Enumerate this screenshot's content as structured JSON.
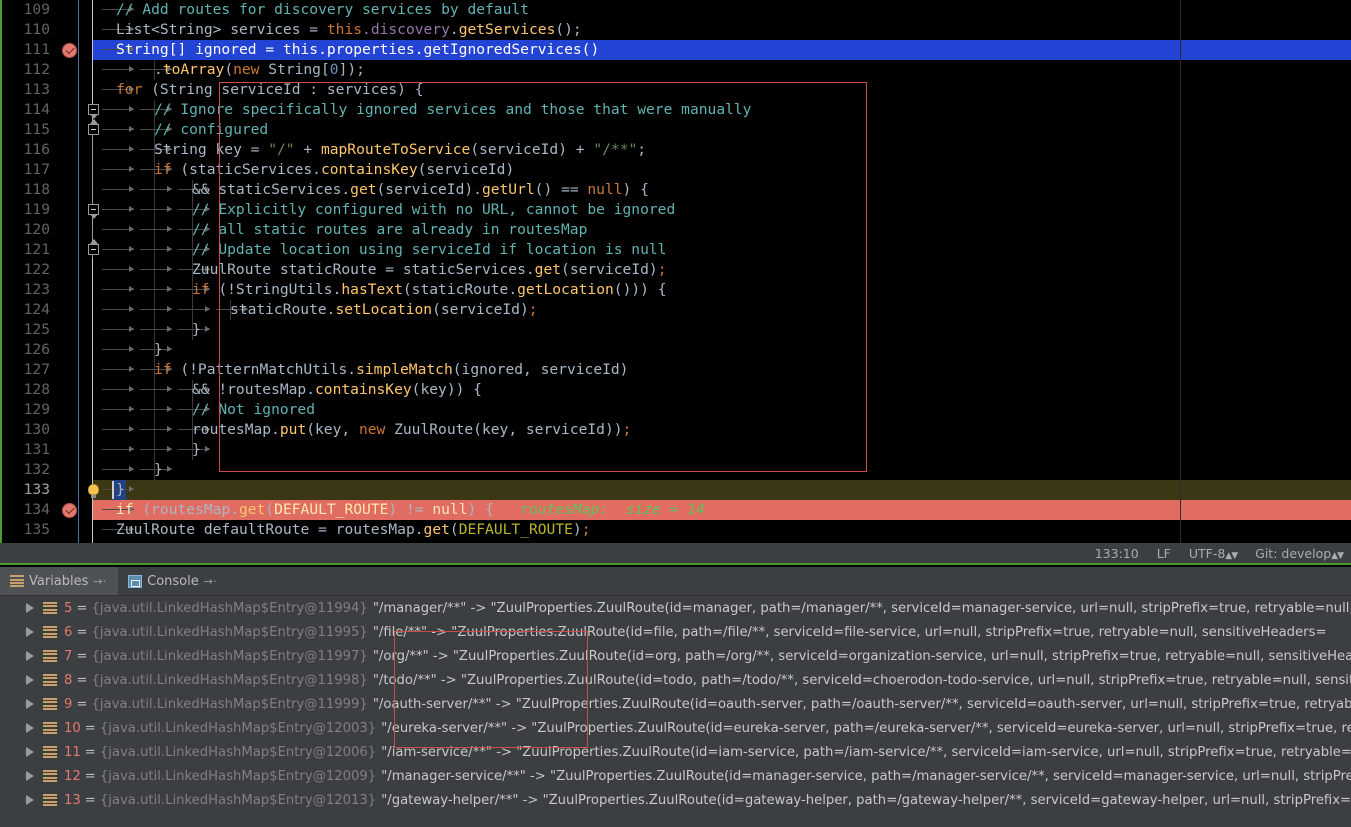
{
  "editor": {
    "first_line": 109,
    "lines": [
      {
        "n": 109,
        "state": "normal",
        "segs": [
          {
            "t": "// Add routes for discovery services by default",
            "c": "cmt2"
          }
        ],
        "indent": 114
      },
      {
        "n": 110,
        "state": "normal",
        "segs": [
          {
            "t": "List<String> services = ",
            "c": "pln"
          },
          {
            "t": "this",
            "c": "kw"
          },
          {
            "t": ".discovery",
            "c": "fld"
          },
          {
            "t": ".",
            "c": "pln"
          },
          {
            "t": "getServices",
            "c": "mth"
          },
          {
            "t": "();",
            "c": "pln"
          }
        ],
        "indent": 114
      },
      {
        "n": 111,
        "state": "exec",
        "segs": [
          {
            "t": "String[] ignored = this.properties.getIgnoredServices()",
            "c": "pln"
          }
        ],
        "indent": 114
      },
      {
        "n": 112,
        "state": "normal",
        "segs": [
          {
            "t": ".",
            "c": "pln"
          },
          {
            "t": "toArray",
            "c": "mth"
          },
          {
            "t": "(",
            "c": "pln"
          },
          {
            "t": "new",
            "c": "kw"
          },
          {
            "t": " String[",
            "c": "pln"
          },
          {
            "t": "0",
            "c": "num"
          },
          {
            "t": "]);",
            "c": "pln"
          }
        ],
        "indent": 152
      },
      {
        "n": 113,
        "state": "normal",
        "segs": [
          {
            "t": "for",
            "c": "kw"
          },
          {
            "t": " (String serviceId : services) {",
            "c": "pln"
          }
        ],
        "indent": 114
      },
      {
        "n": 114,
        "state": "normal",
        "segs": [
          {
            "t": "// Ignore specifically ignored services and those that were manually",
            "c": "cmt2"
          }
        ],
        "indent": 152
      },
      {
        "n": 115,
        "state": "normal",
        "segs": [
          {
            "t": "// configured",
            "c": "cmt2"
          }
        ],
        "indent": 152
      },
      {
        "n": 116,
        "state": "normal",
        "segs": [
          {
            "t": "String key = ",
            "c": "pln"
          },
          {
            "t": "\"/\"",
            "c": "str"
          },
          {
            "t": " + ",
            "c": "pln"
          },
          {
            "t": "mapRouteToService",
            "c": "mth"
          },
          {
            "t": "(serviceId) + ",
            "c": "pln"
          },
          {
            "t": "\"/**\"",
            "c": "str"
          },
          {
            "t": ";",
            "c": "pln"
          }
        ],
        "indent": 152
      },
      {
        "n": 117,
        "state": "normal",
        "segs": [
          {
            "t": "if",
            "c": "kw"
          },
          {
            "t": " (staticServices.",
            "c": "pln"
          },
          {
            "t": "containsKey",
            "c": "mth"
          },
          {
            "t": "(serviceId)",
            "c": "pln"
          }
        ],
        "indent": 152
      },
      {
        "n": 118,
        "state": "normal",
        "segs": [
          {
            "t": "&& staticServices.",
            "c": "pln"
          },
          {
            "t": "get",
            "c": "mth"
          },
          {
            "t": "(serviceId).",
            "c": "pln"
          },
          {
            "t": "getUrl",
            "c": "mth"
          },
          {
            "t": "() == ",
            "c": "pln"
          },
          {
            "t": "null",
            "c": "kw"
          },
          {
            "t": ") {",
            "c": "pln"
          }
        ],
        "indent": 190
      },
      {
        "n": 119,
        "state": "normal",
        "segs": [
          {
            "t": "// Explicitly configured with no URL, cannot be ignored",
            "c": "cmt2"
          }
        ],
        "indent": 190
      },
      {
        "n": 120,
        "state": "normal",
        "segs": [
          {
            "t": "// all static routes are already in routesMap",
            "c": "cmt2"
          }
        ],
        "indent": 190
      },
      {
        "n": 121,
        "state": "normal",
        "segs": [
          {
            "t": "// Update location using serviceId if location is null",
            "c": "cmt2"
          }
        ],
        "indent": 190
      },
      {
        "n": 122,
        "state": "normal",
        "segs": [
          {
            "t": "ZuulRoute staticRoute = staticServices.",
            "c": "pln"
          },
          {
            "t": "get",
            "c": "mth"
          },
          {
            "t": "(serviceId)",
            "c": "pln"
          },
          {
            "t": ";",
            "c": "kw"
          }
        ],
        "indent": 190
      },
      {
        "n": 123,
        "state": "normal",
        "segs": [
          {
            "t": "if",
            "c": "kw"
          },
          {
            "t": " (!StringUtils.",
            "c": "pln"
          },
          {
            "t": "hasText",
            "c": "mth"
          },
          {
            "t": "(staticRoute.",
            "c": "pln"
          },
          {
            "t": "getLocation",
            "c": "mth"
          },
          {
            "t": "())) {",
            "c": "pln"
          }
        ],
        "indent": 190
      },
      {
        "n": 124,
        "state": "normal",
        "segs": [
          {
            "t": "staticRoute.",
            "c": "pln"
          },
          {
            "t": "setLocation",
            "c": "mth"
          },
          {
            "t": "(serviceId)",
            "c": "pln"
          },
          {
            "t": ";",
            "c": "kw"
          }
        ],
        "indent": 228
      },
      {
        "n": 125,
        "state": "normal",
        "segs": [
          {
            "t": "}",
            "c": "pln"
          }
        ],
        "indent": 190
      },
      {
        "n": 126,
        "state": "normal",
        "segs": [
          {
            "t": "}",
            "c": "pln"
          }
        ],
        "indent": 152
      },
      {
        "n": 127,
        "state": "normal",
        "segs": [
          {
            "t": "if",
            "c": "kw"
          },
          {
            "t": " (!PatternMatchUtils.",
            "c": "pln"
          },
          {
            "t": "simpleMatch",
            "c": "mth"
          },
          {
            "t": "(ignored, serviceId)",
            "c": "pln"
          }
        ],
        "indent": 152
      },
      {
        "n": 128,
        "state": "normal",
        "segs": [
          {
            "t": "&& !routesMap.",
            "c": "pln"
          },
          {
            "t": "containsKey",
            "c": "mth"
          },
          {
            "t": "(key)) {",
            "c": "pln"
          }
        ],
        "indent": 190
      },
      {
        "n": 129,
        "state": "normal",
        "segs": [
          {
            "t": "// Not ignored",
            "c": "cmt2"
          }
        ],
        "indent": 190
      },
      {
        "n": 130,
        "state": "normal",
        "segs": [
          {
            "t": "routesMap.",
            "c": "pln"
          },
          {
            "t": "put",
            "c": "mth"
          },
          {
            "t": "(key, ",
            "c": "pln"
          },
          {
            "t": "new",
            "c": "kw"
          },
          {
            "t": " ZuulRoute(key, serviceId))",
            "c": "pln"
          },
          {
            "t": ";",
            "c": "kw"
          }
        ],
        "indent": 190
      },
      {
        "n": 131,
        "state": "normal",
        "segs": [
          {
            "t": "}",
            "c": "pln"
          }
        ],
        "indent": 190
      },
      {
        "n": 132,
        "state": "normal",
        "segs": [
          {
            "t": "}",
            "c": "pln"
          }
        ],
        "indent": 152
      },
      {
        "n": 133,
        "state": "caret",
        "segs": [
          {
            "t": "}",
            "c": "pln"
          }
        ],
        "indent": 114
      },
      {
        "n": 134,
        "state": "bp",
        "segs": [
          {
            "t": "if",
            "c": "kw"
          },
          {
            "t": " (routesMap.",
            "c": "pln"
          },
          {
            "t": "get",
            "c": "mth"
          },
          {
            "t": "(",
            "c": "pln"
          },
          {
            "t": "DEFAULT_ROUTE",
            "c": "stc"
          },
          {
            "t": ") != ",
            "c": "pln"
          },
          {
            "t": "null",
            "c": "kw"
          },
          {
            "t": ") {",
            "c": "pln"
          }
        ],
        "indent": 114,
        "hint": "routesMap:  size = 14"
      },
      {
        "n": 135,
        "state": "normal",
        "segs": [
          {
            "t": "ZuulRoute defaultRoute = routesMap.",
            "c": "pln"
          },
          {
            "t": "get",
            "c": "mth"
          },
          {
            "t": "(",
            "c": "pln"
          },
          {
            "t": "DEFAULT_ROUTE",
            "c": "stc"
          },
          {
            "t": ")",
            "c": "pln"
          },
          {
            "t": ";",
            "c": "kw"
          }
        ],
        "indent": 114
      }
    ],
    "breakpoint_lines": [
      111,
      134
    ],
    "bulb_line": 133,
    "execution_line": 111,
    "caret_line": 133,
    "inline_hint_line": 134,
    "inline_hint_text": "routesMap:  size = 14",
    "red_box_color": "#cc4b4b"
  },
  "status_bar": {
    "caret_position": "133:10",
    "line_separator": "LF",
    "encoding": "UTF-8",
    "vcs_branch": "Git: develop"
  },
  "debug": {
    "tabs": [
      {
        "label": "Variables",
        "icon": "list-icon",
        "active": true
      },
      {
        "label": "Console",
        "icon": "console-icon",
        "active": false
      }
    ],
    "tab_arrow": "→·"
  },
  "variables": {
    "rows": [
      {
        "index": "5",
        "type": "{java.util.LinkedHashMap$Entry@11994}",
        "value": "\"/manager/**\" -> \"ZuulProperties.ZuulRoute(id=manager, path=/manager/**, serviceId=manager-service, url=null, stripPrefix=true, retryable=null, sensit"
      },
      {
        "index": "6",
        "type": "{java.util.LinkedHashMap$Entry@11995}",
        "value": "\"/file/**\" -> \"ZuulProperties.ZuulRoute(id=file, path=/file/**, serviceId=file-service, url=null, stripPrefix=true, retryable=null, sensitiveHeaders="
      },
      {
        "index": "7",
        "type": "{java.util.LinkedHashMap$Entry@11997}",
        "value": "\"/org/**\" -> \"ZuulProperties.ZuulRoute(id=org, path=/org/**, serviceId=organization-service, url=null, stripPrefix=true, retryable=null, sensitiveHea"
      },
      {
        "index": "8",
        "type": "{java.util.LinkedHashMap$Entry@11998}",
        "value": "\"/todo/**\" -> \"ZuulProperties.ZuulRoute(id=todo, path=/todo/**, serviceId=choerodon-todo-service, url=null, stripPrefix=true, retryable=null, sensiti"
      },
      {
        "index": "9",
        "type": "{java.util.LinkedHashMap$Entry@11999}",
        "value": "\"/oauth-server/**\" -> \"ZuulProperties.ZuulRoute(id=oauth-server, path=/oauth-server/**, serviceId=oauth-server, url=null, stripPrefix=true, retryabl"
      },
      {
        "index": "10",
        "type": "{java.util.LinkedHashMap$Entry@12003}",
        "value": "\"/eureka-server/**\" -> \"ZuulProperties.ZuulRoute(id=eureka-server, path=/eureka-server/**, serviceId=eureka-server, url=null, stripPrefix=true, retr"
      },
      {
        "index": "11",
        "type": "{java.util.LinkedHashMap$Entry@12006}",
        "value": "\"/iam-service/**\" -> \"ZuulProperties.ZuulRoute(id=iam-service, path=/iam-service/**, serviceId=iam-service, url=null, stripPrefix=true, retryable=nul"
      },
      {
        "index": "12",
        "type": "{java.util.LinkedHashMap$Entry@12009}",
        "value": "\"/manager-service/**\" -> \"ZuulProperties.ZuulRoute(id=manager-service, path=/manager-service/**, serviceId=manager-service, url=null, stripPrefix=tr"
      },
      {
        "index": "13",
        "type": "{java.util.LinkedHashMap$Entry@12013}",
        "value": "\"/gateway-helper/**\" -> \"ZuulProperties.ZuulRoute(id=gateway-helper, path=/gateway-helper/**, serviceId=gateway-helper, url=null, stripPrefix=true, r"
      }
    ],
    "red_box_color": "#cc4b4b"
  }
}
